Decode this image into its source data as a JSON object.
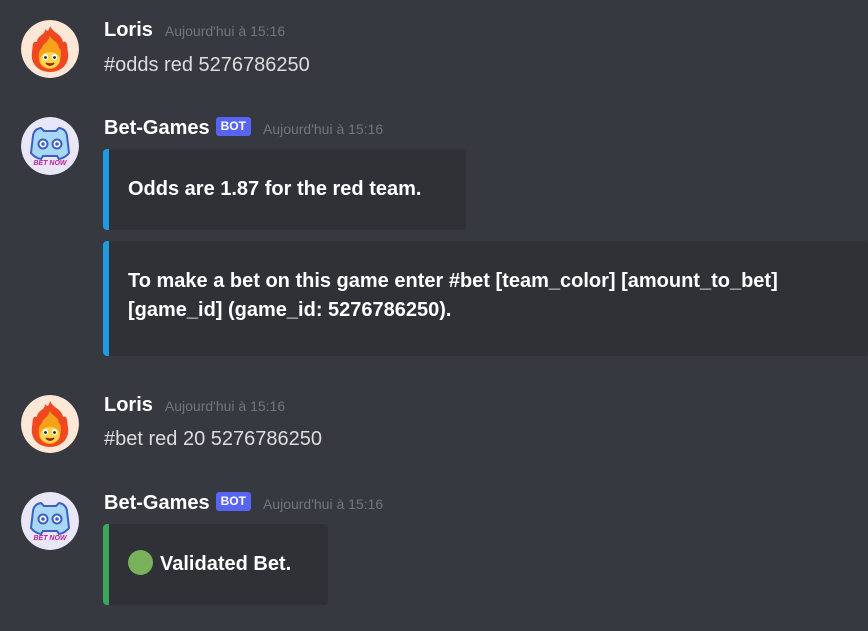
{
  "messages": [
    {
      "author": "Loris",
      "timestamp": "Aujourd'hui à 15:16",
      "text": "#odds red 5276786250",
      "avatar_icon": "fire-character-icon"
    },
    {
      "author": "Bet-Games",
      "bot_tag": "BOT",
      "timestamp": "Aujourd'hui à 15:16",
      "avatar_icon": "bet-now-bot-icon",
      "avatar_text": "BET NOW",
      "embeds": [
        {
          "text": "Odds are 1.87 for the red team.",
          "color": "#1e9ae0"
        },
        {
          "text": "To make a bet on this game enter #bet [team_color] [amount_to_bet] [game_id] (game_id: 5276786250).",
          "color": "#1e9ae0"
        }
      ]
    },
    {
      "author": "Loris",
      "timestamp": "Aujourd'hui à 15:16",
      "text": "#bet red 20 5276786250",
      "avatar_icon": "fire-character-icon"
    },
    {
      "author": "Bet-Games",
      "bot_tag": "BOT",
      "timestamp": "Aujourd'hui à 15:16",
      "avatar_icon": "bet-now-bot-icon",
      "avatar_text": "BET NOW",
      "embeds": [
        {
          "text": "Validated Bet.",
          "color": "#3ba55c",
          "status_icon": "green-circle-icon"
        }
      ]
    }
  ],
  "colors": {
    "background": "#36393f",
    "embed_background": "#2f3136",
    "bot_tag": "#5865f2",
    "timestamp": "#72767d"
  }
}
